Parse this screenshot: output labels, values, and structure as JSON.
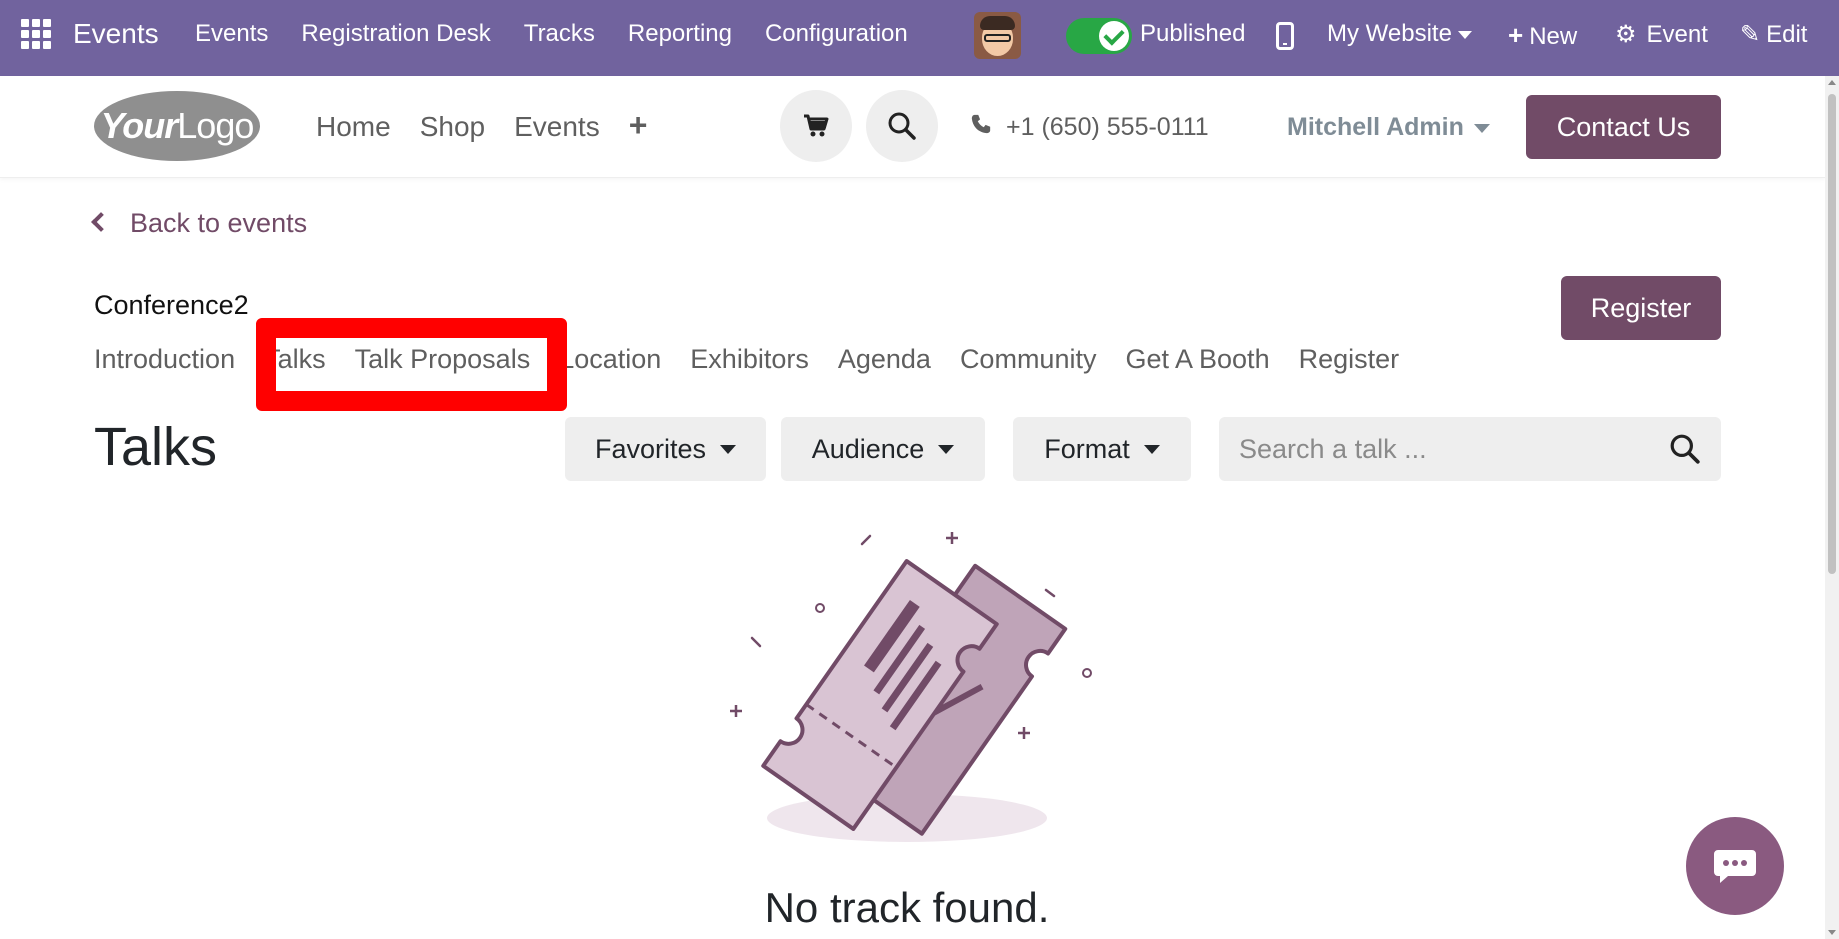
{
  "admin_bar": {
    "app_name": "Events",
    "menu": [
      "Events",
      "Registration Desk",
      "Tracks",
      "Reporting",
      "Configuration"
    ],
    "published_label": "Published",
    "website_label": "My Website",
    "new_label": "New",
    "event_label": "Event",
    "edit_label": "Edit",
    "icons": {
      "apps": "apps-grid-icon",
      "mobile": "mobile-preview-icon",
      "plus": "plus-icon",
      "gear": "gear-icon",
      "pencil": "pencil-icon"
    },
    "color": "#71639e"
  },
  "site_header": {
    "logo_part1": "Your",
    "logo_part2": "Logo",
    "nav": [
      "Home",
      "Shop",
      "Events"
    ],
    "add_icon": "+",
    "phone": "+1 (650) 555-0111",
    "user": "Mitchell Admin",
    "contact_label": "Contact Us",
    "brand_color": "#714b67"
  },
  "event": {
    "back_label": "Back to events",
    "name": "Conference2",
    "register_label": "Register",
    "tabs": [
      "Introduction",
      "Talks",
      "Talk Proposals",
      "Location",
      "Exhibitors",
      "Agenda",
      "Community",
      "Get A Booth",
      "Register"
    ]
  },
  "talks": {
    "title": "Talks",
    "filters": {
      "favorites": "Favorites",
      "audience": "Audience",
      "format": "Format"
    },
    "search_placeholder": "Search a talk ...",
    "empty_message": "No track found."
  },
  "annotation": {
    "highlight_color": "#ff0000"
  }
}
